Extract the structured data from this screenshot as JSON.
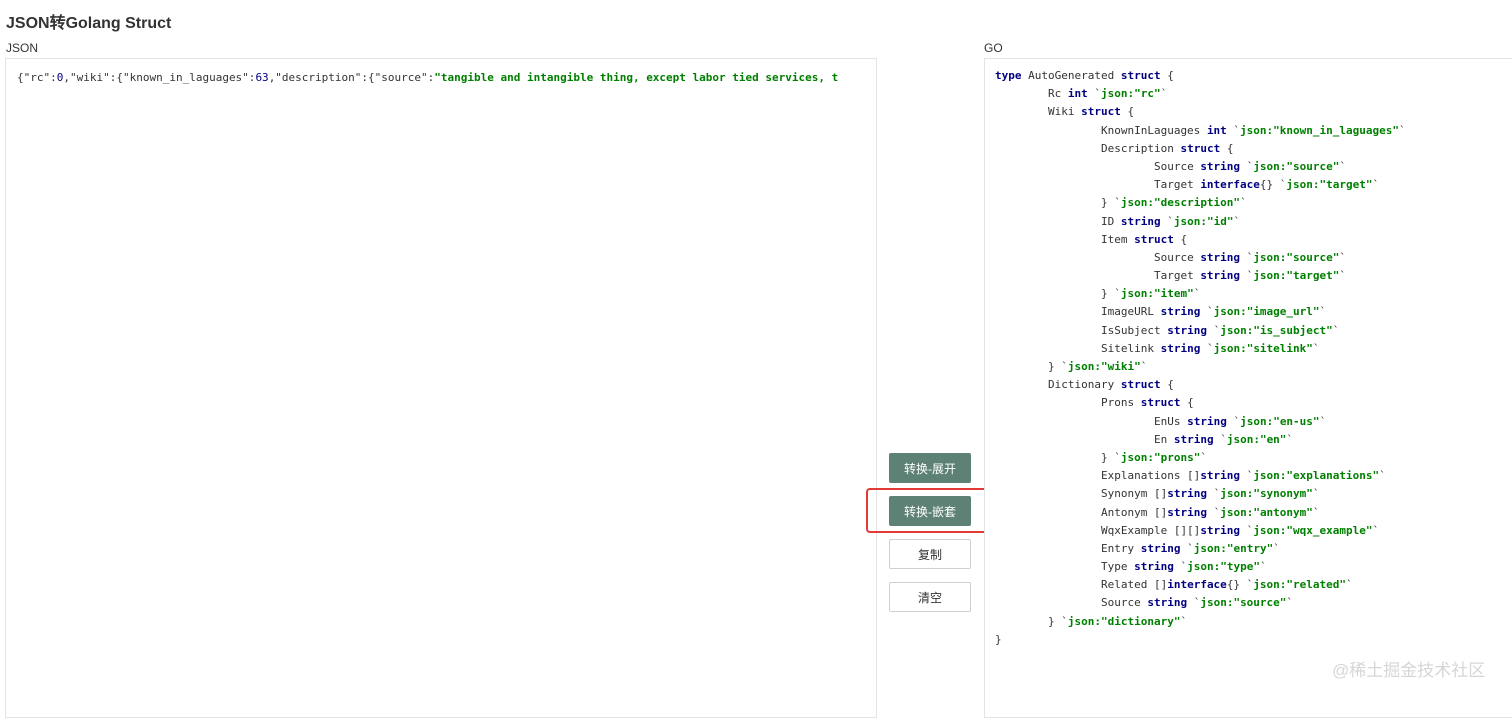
{
  "page": {
    "title": "JSON转Golang Struct"
  },
  "json_pane": {
    "label": "JSON",
    "content": [
      {
        "t": "{\"rc\":",
        "c": ""
      },
      {
        "t": "0",
        "c": "num"
      },
      {
        "t": ",\"wiki\":{\"known_in_laguages\":",
        "c": ""
      },
      {
        "t": "63",
        "c": "num"
      },
      {
        "t": ",\"description\":{\"source\":",
        "c": ""
      },
      {
        "t": "\"tangible and intangible thing, except labor tied services, t",
        "c": "str"
      }
    ]
  },
  "go_pane": {
    "label": "GO",
    "lines": [
      [
        {
          "t": "type",
          "c": "kw"
        },
        {
          "t": " AutoGenerated "
        },
        {
          "t": "struct",
          "c": "kw"
        },
        {
          "t": " {"
        }
      ],
      [
        {
          "t": "\t"
        },
        {
          "t": "Rc "
        },
        {
          "t": "int",
          "c": "kw"
        },
        {
          "t": " `",
          "c": "tick"
        },
        {
          "t": "json:\"rc\"",
          "c": "str"
        },
        {
          "t": "`",
          "c": "tick"
        }
      ],
      [
        {
          "t": "\t"
        },
        {
          "t": "Wiki "
        },
        {
          "t": "struct",
          "c": "kw"
        },
        {
          "t": " {"
        }
      ],
      [
        {
          "t": "\t\t"
        },
        {
          "t": "KnownInLaguages "
        },
        {
          "t": "int",
          "c": "kw"
        },
        {
          "t": " `",
          "c": "tick"
        },
        {
          "t": "json:\"known_in_laguages\"",
          "c": "str"
        },
        {
          "t": "`",
          "c": "tick"
        }
      ],
      [
        {
          "t": "\t\t"
        },
        {
          "t": "Description "
        },
        {
          "t": "struct",
          "c": "kw"
        },
        {
          "t": " {"
        }
      ],
      [
        {
          "t": "\t\t\t"
        },
        {
          "t": "Source "
        },
        {
          "t": "string",
          "c": "kw"
        },
        {
          "t": " `",
          "c": "tick"
        },
        {
          "t": "json:\"source\"",
          "c": "str"
        },
        {
          "t": "`",
          "c": "tick"
        }
      ],
      [
        {
          "t": "\t\t\t"
        },
        {
          "t": "Target "
        },
        {
          "t": "interface",
          "c": "kw"
        },
        {
          "t": "{} `",
          "c": "tick"
        },
        {
          "t": "json:\"target\"",
          "c": "str"
        },
        {
          "t": "`",
          "c": "tick"
        }
      ],
      [
        {
          "t": "\t\t"
        },
        {
          "t": "} `"
        },
        {
          "t": "json:\"description\"",
          "c": "str"
        },
        {
          "t": "`",
          "c": "tick"
        }
      ],
      [
        {
          "t": "\t\t"
        },
        {
          "t": "ID "
        },
        {
          "t": "string",
          "c": "kw"
        },
        {
          "t": " `",
          "c": "tick"
        },
        {
          "t": "json:\"id\"",
          "c": "str"
        },
        {
          "t": "`",
          "c": "tick"
        }
      ],
      [
        {
          "t": "\t\t"
        },
        {
          "t": "Item "
        },
        {
          "t": "struct",
          "c": "kw"
        },
        {
          "t": " {"
        }
      ],
      [
        {
          "t": "\t\t\t"
        },
        {
          "t": "Source "
        },
        {
          "t": "string",
          "c": "kw"
        },
        {
          "t": " `",
          "c": "tick"
        },
        {
          "t": "json:\"source\"",
          "c": "str"
        },
        {
          "t": "`",
          "c": "tick"
        }
      ],
      [
        {
          "t": "\t\t\t"
        },
        {
          "t": "Target "
        },
        {
          "t": "string",
          "c": "kw"
        },
        {
          "t": " `",
          "c": "tick"
        },
        {
          "t": "json:\"target\"",
          "c": "str"
        },
        {
          "t": "`",
          "c": "tick"
        }
      ],
      [
        {
          "t": "\t\t"
        },
        {
          "t": "} `"
        },
        {
          "t": "json:\"item\"",
          "c": "str"
        },
        {
          "t": "`",
          "c": "tick"
        }
      ],
      [
        {
          "t": "\t\t"
        },
        {
          "t": "ImageURL "
        },
        {
          "t": "string",
          "c": "kw"
        },
        {
          "t": " `",
          "c": "tick"
        },
        {
          "t": "json:\"image_url\"",
          "c": "str"
        },
        {
          "t": "`",
          "c": "tick"
        }
      ],
      [
        {
          "t": "\t\t"
        },
        {
          "t": "IsSubject "
        },
        {
          "t": "string",
          "c": "kw"
        },
        {
          "t": " `",
          "c": "tick"
        },
        {
          "t": "json:\"is_subject\"",
          "c": "str"
        },
        {
          "t": "`",
          "c": "tick"
        }
      ],
      [
        {
          "t": "\t\t"
        },
        {
          "t": "Sitelink "
        },
        {
          "t": "string",
          "c": "kw"
        },
        {
          "t": " `",
          "c": "tick"
        },
        {
          "t": "json:\"sitelink\"",
          "c": "str"
        },
        {
          "t": "`",
          "c": "tick"
        }
      ],
      [
        {
          "t": "\t"
        },
        {
          "t": "} `"
        },
        {
          "t": "json:\"wiki\"",
          "c": "str"
        },
        {
          "t": "`",
          "c": "tick"
        }
      ],
      [
        {
          "t": "\t"
        },
        {
          "t": "Dictionary "
        },
        {
          "t": "struct",
          "c": "kw"
        },
        {
          "t": " {"
        }
      ],
      [
        {
          "t": "\t\t"
        },
        {
          "t": "Prons "
        },
        {
          "t": "struct",
          "c": "kw"
        },
        {
          "t": " {"
        }
      ],
      [
        {
          "t": "\t\t\t"
        },
        {
          "t": "EnUs "
        },
        {
          "t": "string",
          "c": "kw"
        },
        {
          "t": " `",
          "c": "tick"
        },
        {
          "t": "json:\"en-us\"",
          "c": "str"
        },
        {
          "t": "`",
          "c": "tick"
        }
      ],
      [
        {
          "t": "\t\t\t"
        },
        {
          "t": "En "
        },
        {
          "t": "string",
          "c": "kw"
        },
        {
          "t": " `",
          "c": "tick"
        },
        {
          "t": "json:\"en\"",
          "c": "str"
        },
        {
          "t": "`",
          "c": "tick"
        }
      ],
      [
        {
          "t": "\t\t"
        },
        {
          "t": "} `"
        },
        {
          "t": "json:\"prons\"",
          "c": "str"
        },
        {
          "t": "`",
          "c": "tick"
        }
      ],
      [
        {
          "t": "\t\t"
        },
        {
          "t": "Explanations []"
        },
        {
          "t": "string",
          "c": "kw"
        },
        {
          "t": " `",
          "c": "tick"
        },
        {
          "t": "json:\"explanations\"",
          "c": "str"
        },
        {
          "t": "`",
          "c": "tick"
        }
      ],
      [
        {
          "t": "\t\t"
        },
        {
          "t": "Synonym []"
        },
        {
          "t": "string",
          "c": "kw"
        },
        {
          "t": " `",
          "c": "tick"
        },
        {
          "t": "json:\"synonym\"",
          "c": "str"
        },
        {
          "t": "`",
          "c": "tick"
        }
      ],
      [
        {
          "t": "\t\t"
        },
        {
          "t": "Antonym []"
        },
        {
          "t": "string",
          "c": "kw"
        },
        {
          "t": " `",
          "c": "tick"
        },
        {
          "t": "json:\"antonym\"",
          "c": "str"
        },
        {
          "t": "`",
          "c": "tick"
        }
      ],
      [
        {
          "t": "\t\t"
        },
        {
          "t": "WqxExample [][]"
        },
        {
          "t": "string",
          "c": "kw"
        },
        {
          "t": " `",
          "c": "tick"
        },
        {
          "t": "json:\"wqx_example\"",
          "c": "str"
        },
        {
          "t": "`",
          "c": "tick"
        }
      ],
      [
        {
          "t": "\t\t"
        },
        {
          "t": "Entry "
        },
        {
          "t": "string",
          "c": "kw"
        },
        {
          "t": " `",
          "c": "tick"
        },
        {
          "t": "json:\"entry\"",
          "c": "str"
        },
        {
          "t": "`",
          "c": "tick"
        }
      ],
      [
        {
          "t": "\t\t"
        },
        {
          "t": "Type "
        },
        {
          "t": "string",
          "c": "kw"
        },
        {
          "t": " `",
          "c": "tick"
        },
        {
          "t": "json:\"type\"",
          "c": "str"
        },
        {
          "t": "`",
          "c": "tick"
        }
      ],
      [
        {
          "t": "\t\t"
        },
        {
          "t": "Related []"
        },
        {
          "t": "interface",
          "c": "kw"
        },
        {
          "t": "{} `",
          "c": "tick"
        },
        {
          "t": "json:\"related\"",
          "c": "str"
        },
        {
          "t": "`",
          "c": "tick"
        }
      ],
      [
        {
          "t": "\t\t"
        },
        {
          "t": "Source "
        },
        {
          "t": "string",
          "c": "kw"
        },
        {
          "t": " `",
          "c": "tick"
        },
        {
          "t": "json:\"source\"",
          "c": "str"
        },
        {
          "t": "`",
          "c": "tick"
        }
      ],
      [
        {
          "t": "\t"
        },
        {
          "t": "} `"
        },
        {
          "t": "json:\"dictionary\"",
          "c": "str"
        },
        {
          "t": "`",
          "c": "tick"
        }
      ],
      [
        {
          "t": "}"
        }
      ]
    ]
  },
  "buttons": {
    "convert_expand": "转换-展开",
    "convert_nested": "转换-嵌套",
    "copy": "复制",
    "clear": "清空"
  },
  "watermark": "@稀土掘金技术社区",
  "colors": {
    "button_primary": "#5e8175",
    "highlight": "#e23a36",
    "keyword": "#000080",
    "string": "#008000"
  }
}
